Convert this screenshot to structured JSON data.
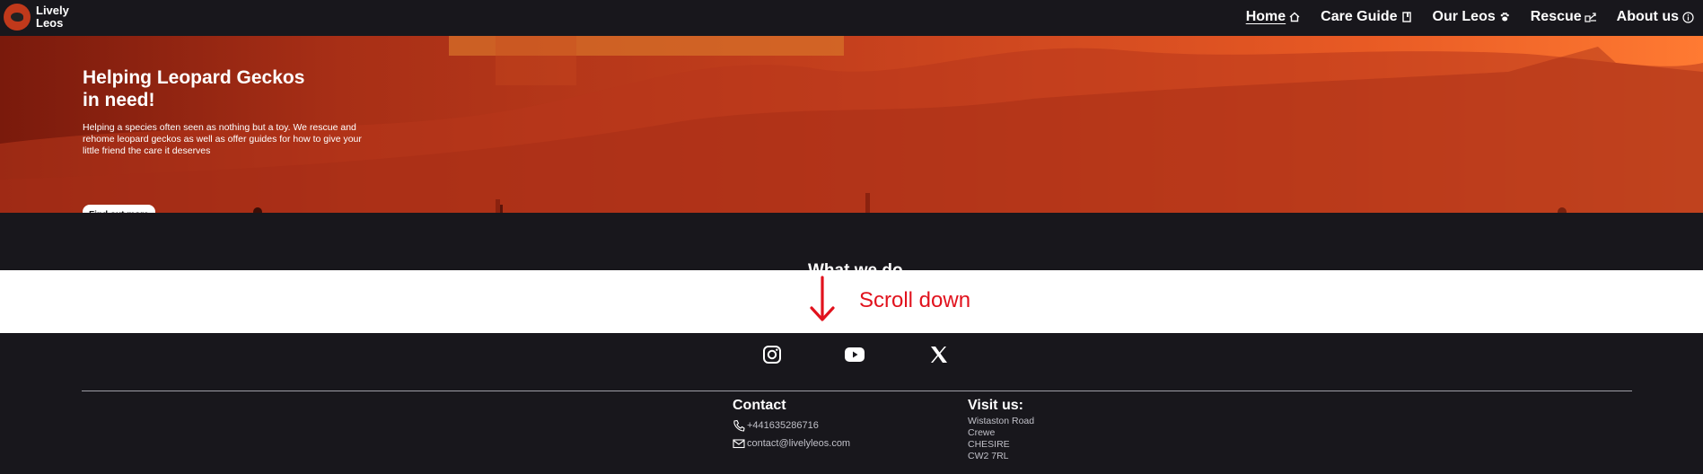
{
  "brand": {
    "line1": "Lively",
    "line2": "Leos"
  },
  "nav": {
    "items": [
      {
        "label": "Home",
        "icon": "home-icon",
        "active": true
      },
      {
        "label": "Care Guide",
        "icon": "book-icon"
      },
      {
        "label": "Our Leos",
        "icon": "paw-icon"
      },
      {
        "label": "Rescue",
        "icon": "rescue-icon"
      },
      {
        "label": "About us",
        "icon": "info-icon"
      }
    ]
  },
  "hero": {
    "title_line1": "Helping Leopard Geckos",
    "title_line2": "in need!",
    "description": "Helping a species often seen as nothing but a toy. We rescue and rehome leopard geckos as well as offer guides for how to give your little friend the care it deserves",
    "button": "Find out more"
  },
  "section": {
    "partial_heading": "What we do"
  },
  "scroll_hint": {
    "label": "Scroll down",
    "color": "#e1121d"
  },
  "footer": {
    "social": [
      "instagram-icon",
      "youtube-icon",
      "x-icon"
    ],
    "contact": {
      "title": "Contact",
      "phone": "+441635286716",
      "email": "contact@livelyleos.com"
    },
    "visit": {
      "title": "Visit us:",
      "lines": [
        "Wistaston Road",
        "Crewe",
        "CHESIRE",
        "CW2 7RL"
      ]
    }
  },
  "colors": {
    "nav_bg": "#18171c",
    "hero_start": "#7a1a0c",
    "hero_end": "#ff7a32"
  }
}
